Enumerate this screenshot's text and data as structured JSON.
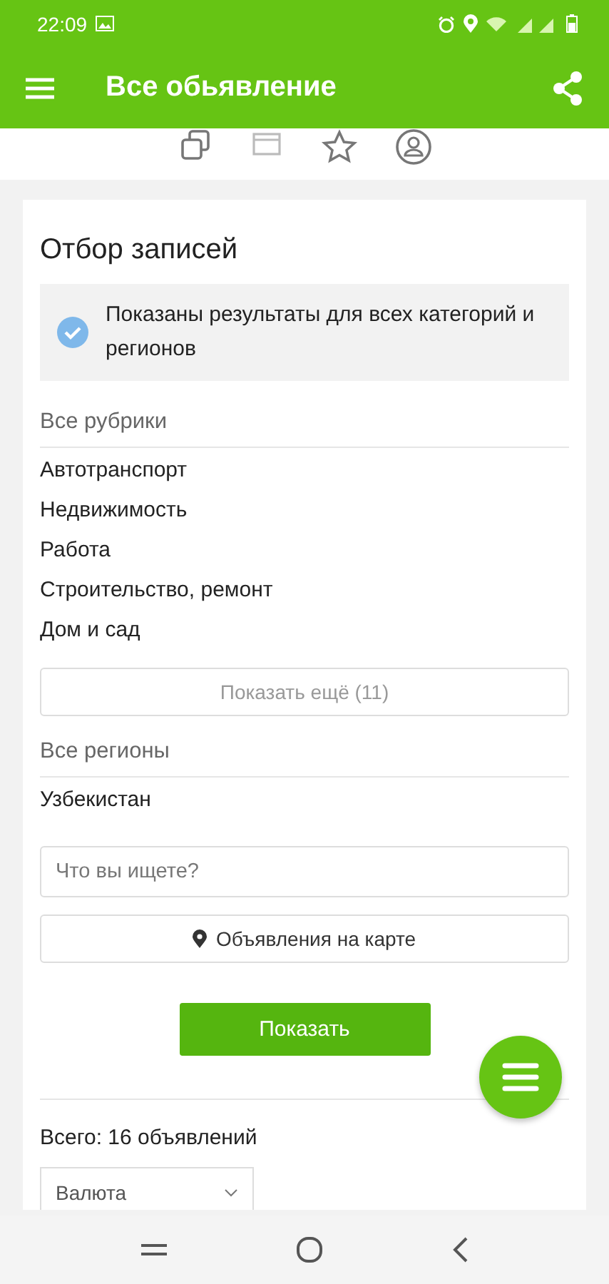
{
  "status_bar": {
    "time": "22:09"
  },
  "app_bar": {
    "title": "Все обьявление"
  },
  "filter": {
    "title": "Отбор записей",
    "notice": "Показаны результаты для всех категорий и регионов",
    "categories_heading": "Все рубрики",
    "categories": [
      "Автотранспорт",
      "Недвижимость",
      "Работа",
      "Строительство, ремонт",
      "Дом и сад"
    ],
    "show_more": "Показать ещё (11)",
    "regions_heading": "Все регионы",
    "regions": [
      "Узбекистан"
    ],
    "search": {
      "placeholder": "Что вы ищете?"
    },
    "map_button": "Объявления на карте",
    "submit": "Показать",
    "total": "Всего: 16 объявлений",
    "currency_select": "Валюта"
  }
}
